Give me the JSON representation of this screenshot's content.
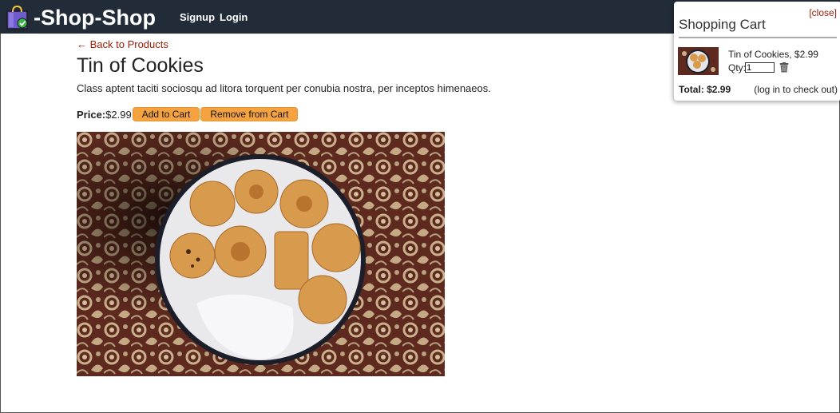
{
  "brand": {
    "name": "-Shop-Shop",
    "icon": "shopping-bag-icon"
  },
  "nav": {
    "signup": "Signup",
    "login": "Login"
  },
  "product": {
    "back_label": "← Back to Products",
    "title": "Tin of Cookies",
    "description": "Class aptent taciti sociosqu ad litora torquent per conubia nostra, per inceptos himenaeos.",
    "price_label": "Price:",
    "price": "$2.99",
    "add_label": "Add to Cart",
    "remove_label": "Remove from Cart",
    "image": "cookie-tin-photo"
  },
  "cart": {
    "close_label": "[close]",
    "title": "Shopping Cart",
    "items": [
      {
        "name": "Tin of Cookies, $2.99",
        "qty_label": "Qty:",
        "qty": "1",
        "thumb": "cookie-tin-thumbnail"
      }
    ],
    "total": "Total: $2.99",
    "note": "(log in to check out)"
  },
  "colors": {
    "navbar": "#222b38",
    "accent_button": "#f5a340",
    "link": "#9b1c05"
  }
}
